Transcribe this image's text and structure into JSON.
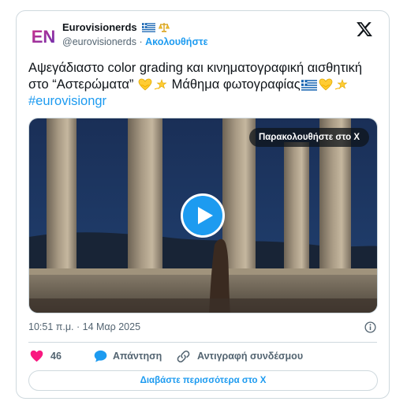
{
  "author": {
    "name": "Eurovisionerds",
    "handle": "@eurovisionerds",
    "separator": "·",
    "follow_label": "Ακολουθήστε",
    "avatar_text": "EN"
  },
  "tweet": {
    "text_part1": "Αψεγάδιαστο color grading και κινηματογραφική αισθητική στο “Αστερώματα” ",
    "text_part2": " Μάθημα φωτογραφίας",
    "hashtag": "#eurovisiongr"
  },
  "media": {
    "watch_label": "Παρακολουθήστε στο X",
    "playing": false
  },
  "meta": {
    "timestamp": "10:51 π.μ. · 14 Μαρ 2025"
  },
  "actions": {
    "likes": "46",
    "reply_label": "Απάντηση",
    "copy_link_label": "Αντιγραφή συνδέσμου"
  },
  "read_more_label": "Διαβάστε περισσότερα στο X",
  "colors": {
    "accent": "#1d9bf0",
    "like": "#f91880",
    "text": "#0f1419",
    "muted": "#536471",
    "border": "#cfd9de"
  }
}
